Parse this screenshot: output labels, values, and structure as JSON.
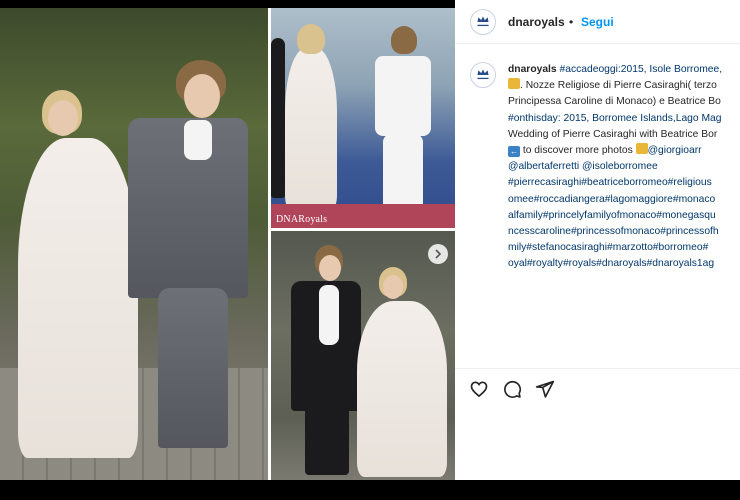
{
  "post": {
    "username": "dnaroyals",
    "follow_label": "Segui",
    "separator": "•",
    "watermark": "DNARoyals",
    "avatar_text": "DNARoyals"
  },
  "caption": {
    "username": "dnaroyals",
    "lines": [
      " #accadeoggi:2015, Isole Borromee,",
      ". Nozze Religiose di Pierre Casiraghi( terzo",
      "Principessa Caroline di Monaco) e Beatrice Bo",
      "#onthisday: 2015, Borromee Islands,Lago Mag",
      "Wedding of Pierre Casiraghi with Beatrice Bor",
      " to discover more photos ",
      "@albertaferretti @isoleborromee",
      "#pierrecasiraghi#beatriceborromeo#religious",
      "omee#roccadiangera#lagomaggiore#monaco",
      "alfamily#princelyfamilyofmonaco#monegasqu",
      "ncesscaroline#princessofmonaco#princessofh",
      "mily#stefanocasiraghi#marzotto#borromeo#",
      "oyal#royalty#royals#dnaroyals#dnaroyals1ag"
    ],
    "mention_inline": "@giorgioarr"
  },
  "actions": {
    "like_icon": "heart-icon",
    "comment_icon": "comment-icon",
    "share_icon": "share-icon"
  },
  "colors": {
    "follow": "#0095f6",
    "hashtag": "#00376b",
    "text": "#262626"
  }
}
